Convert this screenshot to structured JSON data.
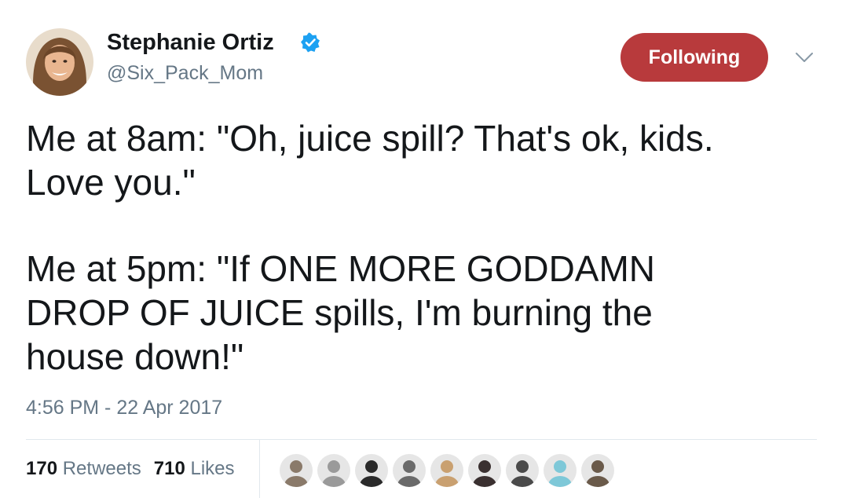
{
  "user": {
    "display_name": "Stephanie Ortiz",
    "handle": "@Six_Pack_Mom",
    "verified": true,
    "avatar_icon": "profile-photo-icon"
  },
  "follow_button": {
    "label": "Following",
    "color": "#b83a3c"
  },
  "menu_icon": "chevron-down-icon",
  "tweet": {
    "lines": [
      "Me at 8am: \"Oh, juice spill? That's ok, kids.",
      "Love you.\"",
      "",
      "Me at 5pm: \"If ONE MORE GODDAMN",
      "DROP OF JUICE spills, I'm burning the",
      "house down!\""
    ]
  },
  "timestamp": "4:56 PM - 22 Apr 2017",
  "stats": {
    "retweets_count": "170",
    "retweets_label": "Retweets",
    "likes_count": "710",
    "likes_label": "Likes"
  },
  "likers": [
    {
      "icon": "liker-avatar-icon",
      "color": "#8a7a6a"
    },
    {
      "icon": "liker-avatar-icon",
      "color": "#9a9a9a"
    },
    {
      "icon": "liker-avatar-icon",
      "color": "#2a2a2a"
    },
    {
      "icon": "liker-avatar-icon",
      "color": "#6a6a6a"
    },
    {
      "icon": "liker-avatar-icon",
      "color": "#c9a070"
    },
    {
      "icon": "liker-avatar-icon",
      "color": "#3a3030"
    },
    {
      "icon": "liker-avatar-icon",
      "color": "#4a4a4a"
    },
    {
      "icon": "liker-avatar-icon",
      "color": "#7ec8d8"
    },
    {
      "icon": "liker-avatar-icon",
      "color": "#6a5a4a"
    }
  ],
  "colors": {
    "text": "#14171a",
    "secondary": "#657786",
    "verified": "#1da1f2",
    "divider": "#e1e8ed"
  }
}
